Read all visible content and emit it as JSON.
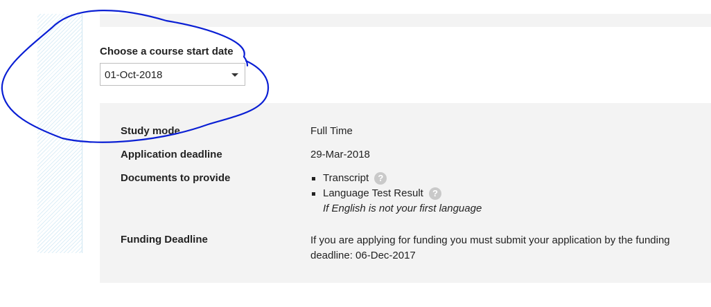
{
  "course": {
    "start_date_label": "Choose a course start date",
    "start_date_value": "01-Oct-2018"
  },
  "details": {
    "study_mode_label": "Study mode",
    "study_mode_value": "Full Time",
    "deadline_label": "Application deadline",
    "deadline_value": "29-Mar-2018",
    "documents_label": "Documents to provide",
    "documents": [
      {
        "name": "Transcript",
        "note": ""
      },
      {
        "name": "Language Test Result",
        "note": "If English is not your first language"
      }
    ],
    "funding_label": "Funding Deadline",
    "funding_text_line1": "If you are applying for funding you must submit your application by the funding",
    "funding_text_line2": "deadline: 06-Dec-2017"
  },
  "icons": {
    "help": "?"
  },
  "colors": {
    "annotation": "#0a1fd4",
    "panel_bg": "#f3f3f3",
    "stripe": "#dceef7"
  }
}
